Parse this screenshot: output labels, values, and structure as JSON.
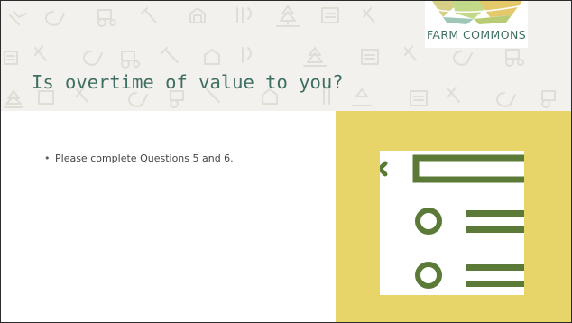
{
  "slide": {
    "title": "Is overtime of value to you?",
    "bullets": [
      "Please complete Questions 5 and 6."
    ]
  },
  "logo": {
    "text": "FARM COMMONS"
  },
  "colors": {
    "title": "#3f6f62",
    "header_bg": "#f3f1ee",
    "pattern": "#e0ddd7",
    "yellow_panel": "#e8d56a",
    "form_green": "#5b7a37",
    "logo_teal": "#3f6f62"
  },
  "icons": {
    "header_pattern": [
      "carrot-icon",
      "chicken-icon",
      "tractor-icon",
      "barn-icon",
      "utensils-icon",
      "tree-icon",
      "sign-icon"
    ],
    "form_art": [
      "checkbox-icon",
      "radio-icon",
      "list-line-icon"
    ]
  }
}
